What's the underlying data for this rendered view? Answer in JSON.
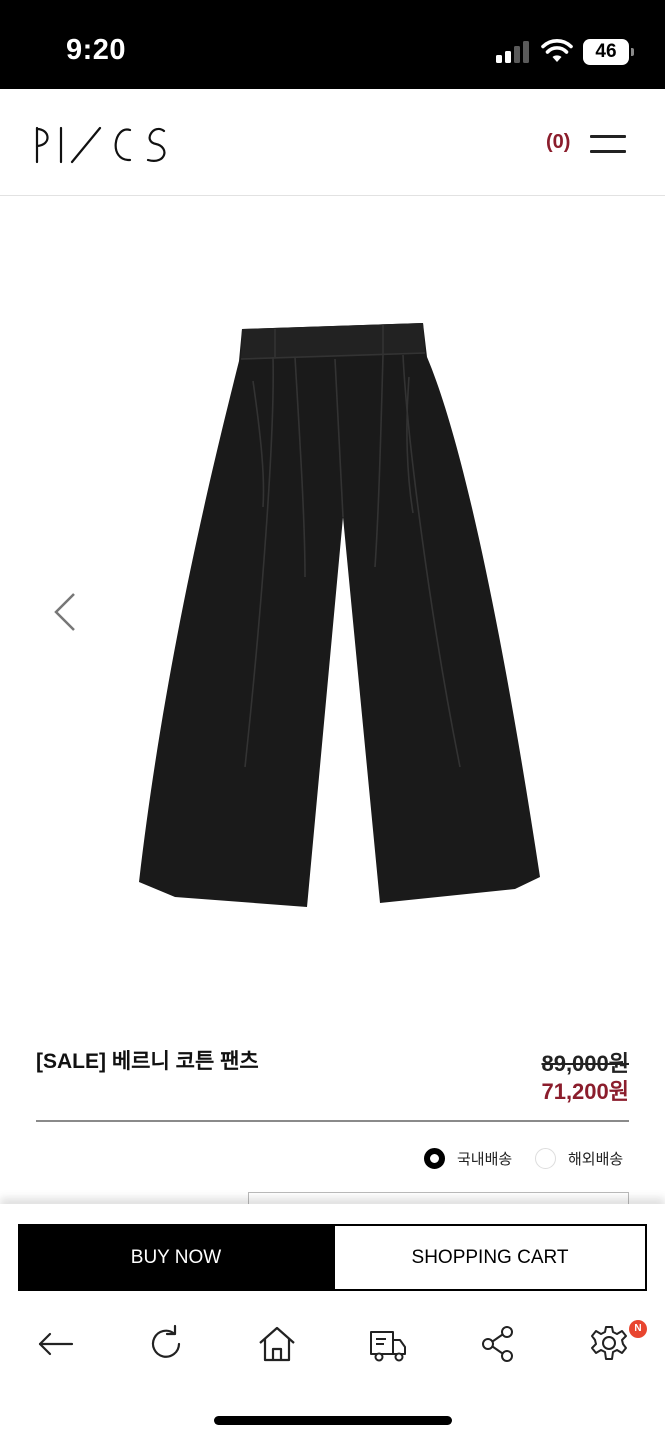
{
  "status_bar": {
    "time": "9:20",
    "battery": "46"
  },
  "header": {
    "logo_alt": "PICS",
    "cart_count": "(0)"
  },
  "product": {
    "name": "[SALE] 베르니 코튼 팬츠",
    "original_price": "89,000원",
    "sale_price": "71,200원",
    "image_icon": "black-wide-pants-image"
  },
  "shipping": {
    "domestic_label": "국내배송",
    "overseas_label": "해외배송",
    "selected": "domestic"
  },
  "actions": {
    "buy_now": "BUY NOW",
    "shopping_cart": "SHOPPING CART"
  },
  "toolbar": {
    "items": [
      "back-icon",
      "refresh-icon",
      "home-icon",
      "delivery-truck-icon",
      "share-icon",
      "settings-icon"
    ],
    "settings_badge": "N"
  },
  "colors": {
    "accent": "#8b1d2c",
    "badge": "#e8452f"
  }
}
